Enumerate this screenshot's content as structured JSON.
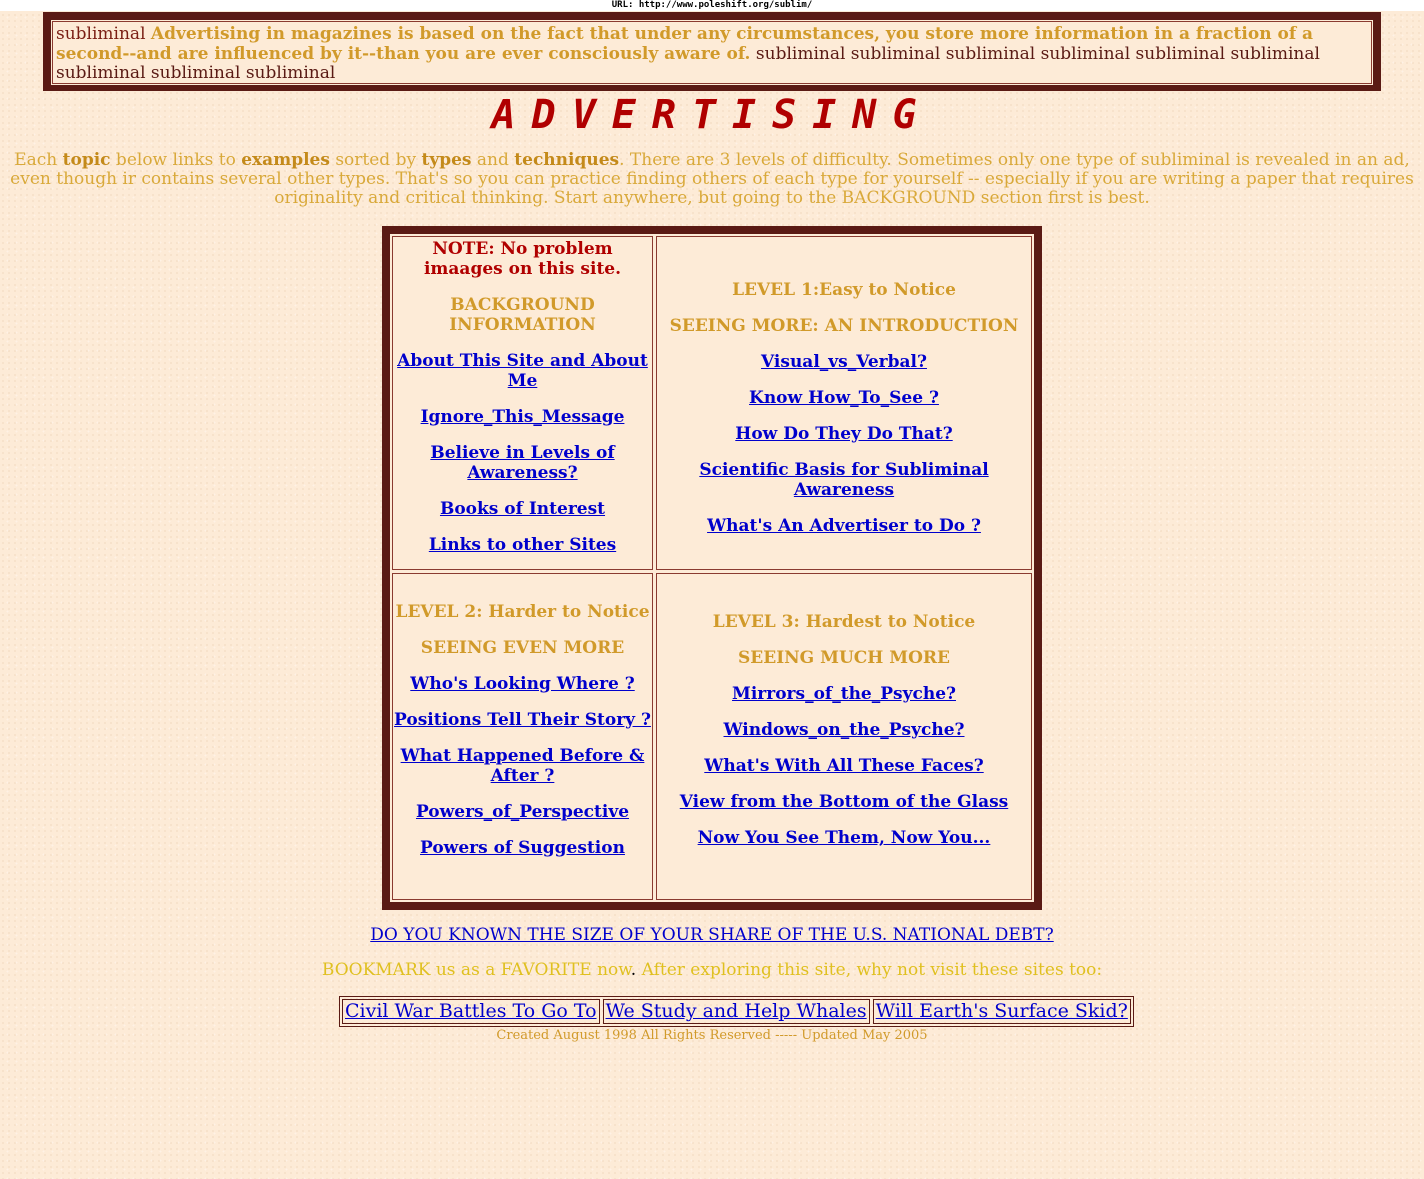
{
  "url_bar": "URL: http://www.poleshift.org/sublim/",
  "banner": {
    "lead": "subliminal",
    "message": "Advertising in magazines is based on the fact that under any circumstances, you store more information in a fraction of a second--and are influenced by it--than you are ever consciously aware of.",
    "tail": "subliminal subliminal subliminal subliminal subliminal subliminal subliminal subliminal subliminal"
  },
  "title": "ADVERTISING",
  "intro": {
    "p1": "Each ",
    "topic": "topic",
    "p2": " below links to ",
    "examples": "examples",
    "p3": " sorted by ",
    "types": "types",
    "p4": " and ",
    "techniques": "techniques",
    "p5": ". There are 3 levels of difficulty. Sometimes only one type of subliminal is revealed in an ad, even though ir contains several other types. That's so you can practice finding others of each type for yourself -- especially if you are writing a paper that requires originality and critical thinking. Start anywhere, but going to the BACKGROUND section first is best."
  },
  "background": {
    "note": "NOTE: No problem imaages on this site.",
    "heading": "BACKGROUND INFORMATION",
    "links": [
      "About This Site and About Me",
      "Ignore_This_Message",
      "Believe in Levels of Awareness?",
      "Books of Interest",
      "Links to other Sites"
    ]
  },
  "level1": {
    "heading": "LEVEL 1:Easy to Notice",
    "subheading": "SEEING MORE: AN INTRODUCTION",
    "links": [
      "Visual_vs_Verbal?",
      "Know How_To_See ?",
      "How Do They Do That?",
      "Scientific Basis for Subliminal Awareness",
      "What's An Advertiser to Do ?"
    ]
  },
  "level2": {
    "heading": "LEVEL 2: Harder to Notice",
    "subheading": "SEEING EVEN MORE",
    "links": [
      "Who's Looking Where ?",
      "Positions Tell Their Story ?",
      "What Happened Before & After ?",
      "Powers_of_Perspective",
      "Powers of Suggestion"
    ]
  },
  "level3": {
    "heading": "LEVEL 3: Hardest to Notice",
    "subheading": "SEEING MUCH MORE",
    "links": [
      "Mirrors_of_the_Psyche?",
      "Windows_on_the_Psyche?",
      "What's With All These Faces?",
      "View from the Bottom of the Glass",
      "Now You See Them, Now You..."
    ]
  },
  "debt_link": "DO YOU KNOWN THE SIZE OF YOUR SHARE OF THE U.S. NATIONAL DEBT?",
  "bookmark": {
    "p1": "BOOKMARK us as a FAVORITE now",
    "dot": ".",
    "p2": " After exploring this site, why not visit these sites too:"
  },
  "sites": [
    "Civil War Battles To Go To",
    "We Study and Help Whales",
    "Will Earth's Surface Skid?"
  ],
  "footer": "Created August 1998 All Rights Reserved ----- Updated May 2005"
}
